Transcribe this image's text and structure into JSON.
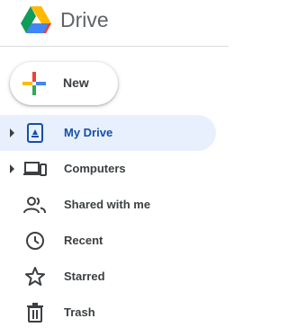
{
  "app": {
    "title": "Drive",
    "logo_icon": "google-drive-logo"
  },
  "new_button": {
    "label": "New",
    "icon": "plus-icon"
  },
  "nav": {
    "active_color": "#174ea6",
    "active_background": "#e8f0fe",
    "items": [
      {
        "label": "My Drive",
        "icon": "my-drive-icon",
        "expandable": true,
        "active": true
      },
      {
        "label": "Computers",
        "icon": "computers-icon",
        "expandable": true,
        "active": false
      },
      {
        "label": "Shared with me",
        "icon": "shared-with-me-icon",
        "expandable": false,
        "active": false
      },
      {
        "label": "Recent",
        "icon": "recent-clock-icon",
        "expandable": false,
        "active": false
      },
      {
        "label": "Starred",
        "icon": "star-icon",
        "expandable": false,
        "active": false
      },
      {
        "label": "Trash",
        "icon": "trash-icon",
        "expandable": false,
        "active": false
      }
    ]
  }
}
